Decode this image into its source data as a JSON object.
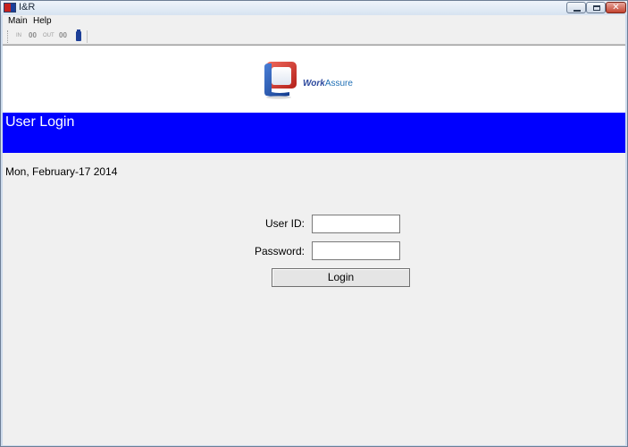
{
  "window": {
    "title": "I&R",
    "minimize_glyph": "",
    "maximize_glyph": "",
    "close_glyph": "✕"
  },
  "menu": {
    "items": [
      {
        "label": "Main"
      },
      {
        "label": "Help"
      }
    ]
  },
  "toolbar": {
    "in_label": "IN",
    "in_count": "00",
    "out_label": "OUT",
    "out_count": "00",
    "battery_icon": "battery-icon"
  },
  "logo": {
    "word1": "Work",
    "word2": "Assure"
  },
  "banner": {
    "title": "User Login",
    "color": "#0000ff"
  },
  "date": "Mon, February-17 2014",
  "form": {
    "user_id_label": "User ID:",
    "user_id_value": "",
    "password_label": "Password:",
    "password_value": "",
    "login_label": "Login"
  }
}
